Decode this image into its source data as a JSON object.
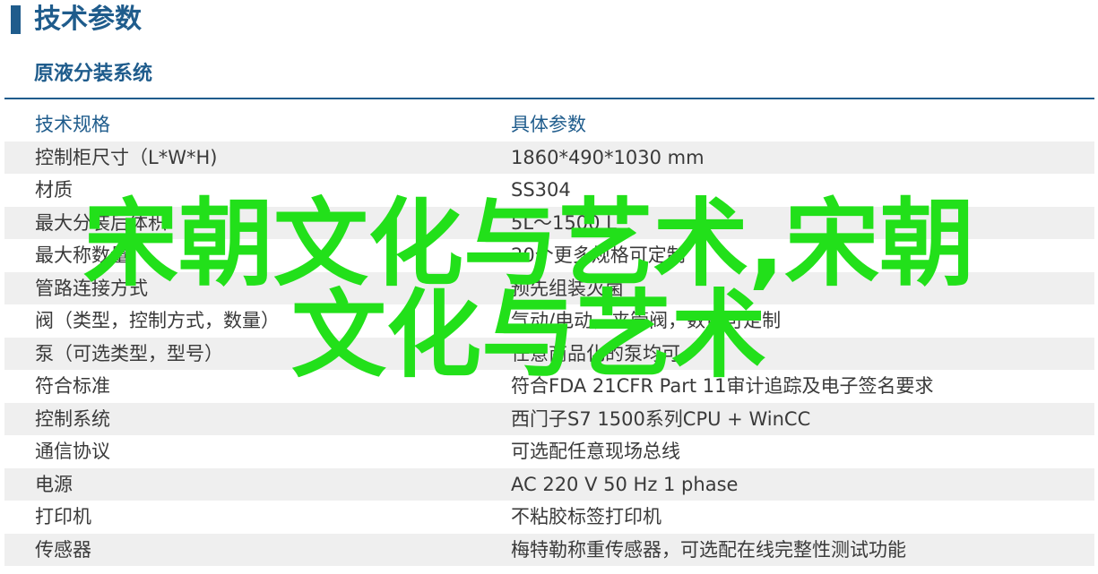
{
  "header": {
    "title": "技术参数"
  },
  "section": {
    "title": "原液分装系统"
  },
  "table": {
    "columns": [
      "技术规格",
      "具体参数"
    ],
    "rows": [
      {
        "key": "控制柜尺寸（L*W*H)",
        "value": "1860*490*1030 mm"
      },
      {
        "key": "材质",
        "value": "SS304"
      },
      {
        "key": "最大分装后体积",
        "value": "5L～1500 L"
      },
      {
        "key": "最大称数量",
        "value": "20个更多规格可定制"
      },
      {
        "key": "管路连接方式",
        "value": "预先组装灭菌"
      },
      {
        "key": "阀（类型，控制方式，数量）",
        "value": "气动/电动，夹管阀，数量可定制"
      },
      {
        "key": "泵（可选类型，型号）",
        "value": "任意商品化的泵均可"
      },
      {
        "key": "符合标准",
        "value": "符合FDA 21CFR Part 11审计追踪及电子签名要求"
      },
      {
        "key": "控制系统",
        "value": "西门子S7 1500系列CPU + WinCC"
      },
      {
        "key": "通信协议",
        "value": "可选配任意现场总线"
      },
      {
        "key": "电源",
        "value": "AC 220 V 50 Hz 1 phase"
      },
      {
        "key": "打印机",
        "value": "不粘胶标签打印机"
      },
      {
        "key": "传感器",
        "value": "梅特勒称重传感器，可选配在线完整性测试功能"
      }
    ]
  },
  "overlay": {
    "text": "宋朝文化与艺术,宋朝文化与艺术",
    "color": "#22e01a"
  },
  "colors": {
    "accent": "#1f5c8c",
    "row_shade": "#efefef"
  }
}
